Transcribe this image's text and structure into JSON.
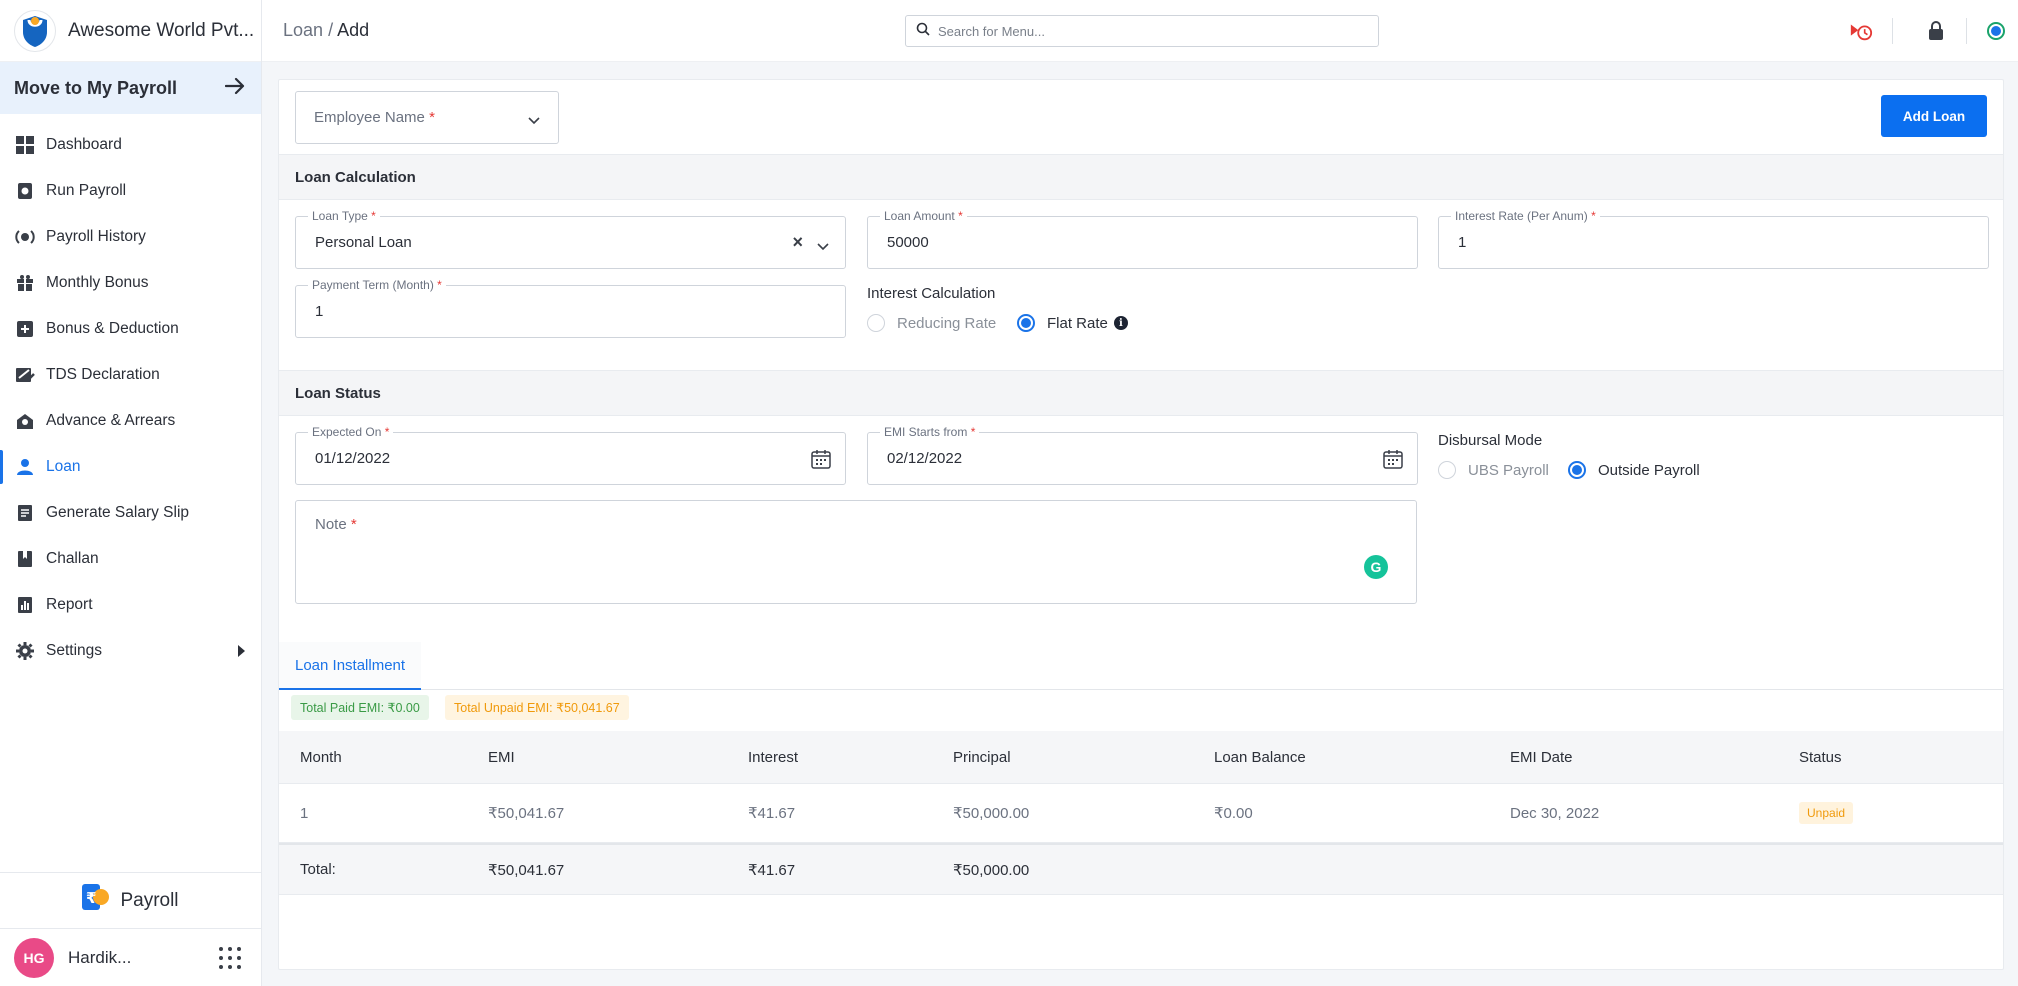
{
  "app": {
    "company": "Awesome World Pvt...",
    "move_label": "Move to My Payroll",
    "product": "Payroll",
    "user_initials": "HG",
    "user_name": "Hardik..."
  },
  "sidebar": {
    "items": [
      {
        "label": "Dashboard",
        "icon": "dashboard-icon"
      },
      {
        "label": "Run Payroll",
        "icon": "run-payroll-icon"
      },
      {
        "label": "Payroll History",
        "icon": "history-icon"
      },
      {
        "label": "Monthly Bonus",
        "icon": "gift-icon"
      },
      {
        "label": "Bonus & Deduction",
        "icon": "bonus-deduction-icon"
      },
      {
        "label": "TDS Declaration",
        "icon": "tds-icon"
      },
      {
        "label": "Advance & Arrears",
        "icon": "advance-icon"
      },
      {
        "label": "Loan",
        "icon": "loan-icon"
      },
      {
        "label": "Generate Salary Slip",
        "icon": "salary-slip-icon"
      },
      {
        "label": "Challan",
        "icon": "challan-icon"
      },
      {
        "label": "Report",
        "icon": "report-icon"
      },
      {
        "label": "Settings",
        "icon": "gear-icon"
      }
    ],
    "active_index": 7
  },
  "header": {
    "breadcrumb_parent": "Loan",
    "breadcrumb_sep": "/",
    "breadcrumb_current": "Add",
    "search_placeholder": "Search for Menu..."
  },
  "form": {
    "employee_placeholder": "Employee Name",
    "required_mark": "*",
    "add_button": "Add Loan",
    "loan_calc_title": "Loan Calculation",
    "loan_type_label": "Loan Type",
    "loan_type_value": "Personal Loan",
    "loan_amount_label": "Loan Amount",
    "loan_amount_value": "50000",
    "interest_rate_label": "Interest Rate (Per Anum)",
    "interest_rate_value": "1",
    "payment_term_label": "Payment Term (Month)",
    "payment_term_value": "1",
    "interest_calc_label": "Interest Calculation",
    "interest_calc_options": [
      "Reducing Rate",
      "Flat Rate"
    ],
    "interest_calc_selected": "Flat Rate",
    "loan_status_title": "Loan Status",
    "expected_on_label": "Expected On",
    "expected_on_value": "01/12/2022",
    "emi_starts_label": "EMI Starts from",
    "emi_starts_value": "02/12/2022",
    "disbursal_label": "Disbursal Mode",
    "disbursal_options": [
      "UBS Payroll",
      "Outside Payroll"
    ],
    "disbursal_selected": "Outside Payroll",
    "note_label": "Note"
  },
  "installment": {
    "tab_label": "Loan Installment",
    "total_paid": "Total Paid EMI: ₹0.00",
    "total_unpaid": "Total Unpaid EMI: ₹50,041.67",
    "columns": [
      "Month",
      "EMI",
      "Interest",
      "Principal",
      "Loan Balance",
      "EMI Date",
      "Status"
    ],
    "rows": [
      {
        "month": "1",
        "emi": "₹50,041.67",
        "interest": "₹41.67",
        "principal": "₹50,000.00",
        "balance": "₹0.00",
        "date": "Dec 30, 2022",
        "status": "Unpaid"
      }
    ],
    "total": {
      "label": "Total:",
      "emi": "₹50,041.67",
      "interest": "₹41.67",
      "principal": "₹50,000.00"
    }
  },
  "colors": {
    "primary": "#0b6ff0",
    "accent_blue": "#1a73e8",
    "paid_green": "#3a9b46",
    "unpaid_orange": "#f09a0c",
    "avatar_pink": "#e94a87"
  }
}
